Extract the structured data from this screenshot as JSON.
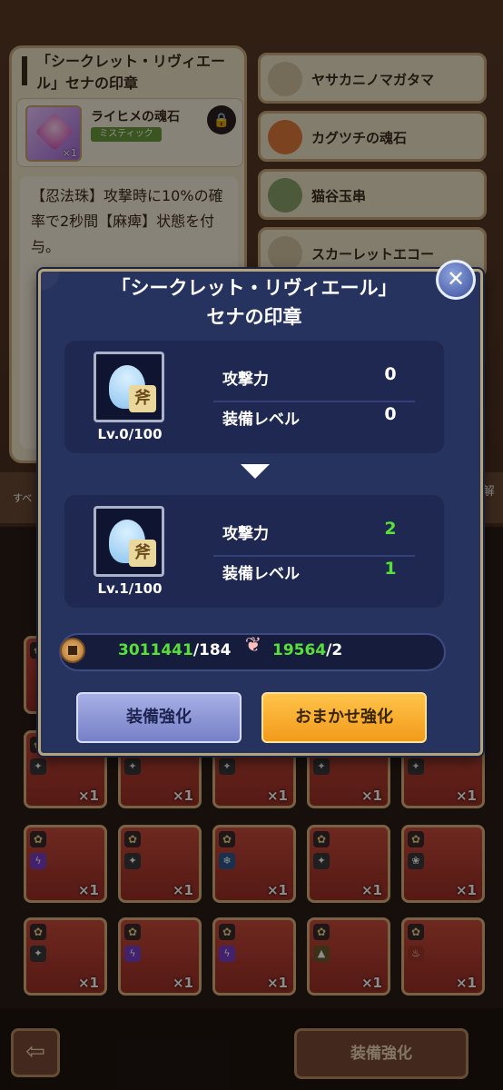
{
  "left_panel": {
    "title": "「シークレット・リヴィエール」セナの印章",
    "item_name": "ライヒメの魂石",
    "rarity": "ミスティック",
    "item_count": "×1",
    "description": "【忍法珠】攻撃時に10%の確率で2秒間【麻痺】状態を付与。"
  },
  "right_list": [
    {
      "label": "ヤサカニノマガタマ",
      "icon": "jewel-icon"
    },
    {
      "label": "カグツチの魂石",
      "icon": "fire-stone-icon"
    },
    {
      "label": "猫谷玉串",
      "icon": "branch-icon"
    },
    {
      "label": "スカーレットエコー",
      "icon": "megaphone-icon"
    }
  ],
  "side_tab": {
    "left": "すべ",
    "right": "して解除"
  },
  "modal": {
    "title_line1": "「シークレット・リヴィエール」",
    "title_line2": "セナの印章",
    "before": {
      "level": "Lv.0/100",
      "attack_label": "攻撃力",
      "attack_value": "0",
      "equip_level_label": "装備レベル",
      "equip_level_value": "0"
    },
    "after": {
      "level": "Lv.1/100",
      "attack_label": "攻撃力",
      "attack_value": "2",
      "equip_level_label": "装備レベル",
      "equip_level_value": "1"
    },
    "skill_glyph": "斧",
    "cost": {
      "coin_have": "3011441",
      "coin_need": "/184",
      "material_have": "19564",
      "material_need": "/2"
    },
    "buttons": {
      "enhance": "装備強化",
      "auto_enhance": "おまかせ強化"
    },
    "close": "✕"
  },
  "grid": {
    "count_label": "×1"
  },
  "bottom": {
    "back": "⇦",
    "enhance": "装備強化"
  },
  "colors": {
    "modal_bg": "#27335f",
    "increase_green": "#58e038",
    "auto_button": "#f29a1a",
    "enhance_button": "#7680c6"
  }
}
